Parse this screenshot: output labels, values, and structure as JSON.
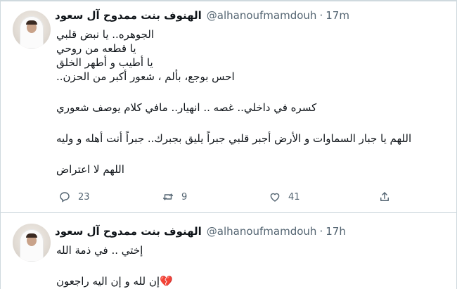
{
  "tweets": [
    {
      "display_name": "الهنوف بنت ممدوح آل سعود",
      "handle": "@alhanoufmamdouh",
      "separator": "·",
      "time": "17m",
      "lines": [
        "الجوهره.. يا نبض قلبي",
        "يا قطعه من روحي",
        "يا أطيب و أطهر الخلق",
        "احس بوجع، بألم ، شعور أكبر من الحزن..",
        "",
        "كسره في داخلي.. غصه .. انهيار.. مافي كلام يوصف شعوري",
        "",
        "اللهم يا جبار السماوات و الأرض أجبر قلبي جبراً يليق بجبرك.. جبراً أنت أهله و وليه",
        "",
        "اللهم لا اعتراض"
      ],
      "actions": {
        "reply_count": "23",
        "retweet_count": "9",
        "like_count": "41"
      }
    },
    {
      "display_name": "الهنوف بنت ممدوح آل سعود",
      "handle": "@alhanoufmamdouh",
      "separator": "·",
      "time": "17h",
      "lines": [
        "إختي .. في ذمة الله",
        "",
        "إن لله و إن اليه راجعون"
      ],
      "emoji": "💔"
    }
  ],
  "icons": {
    "reply": "speech-bubble-icon",
    "retweet": "retweet-arrows-icon",
    "like": "heart-outline-icon",
    "share": "share-upload-icon",
    "more": "more-dots-icon",
    "broken_heart": "broken-heart-emoji"
  },
  "colors": {
    "text": "#0f1419",
    "muted": "#536471",
    "divider": "#cfd9de",
    "broken_heart": "#d0283c"
  }
}
